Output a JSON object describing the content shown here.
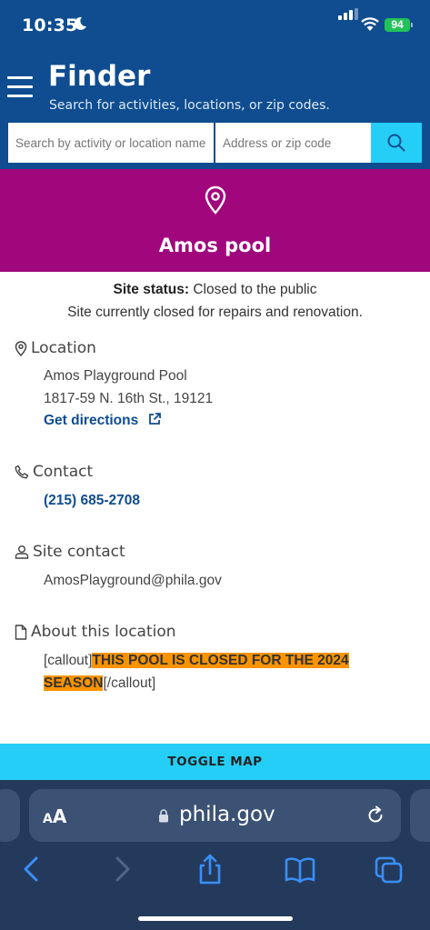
{
  "status_bar": {
    "time": "10:35",
    "battery": "94"
  },
  "header": {
    "title": "Finder",
    "subtitle": "Search for activities, locations, or zip codes.",
    "activity_placeholder": "Search by activity or location name",
    "address_placeholder": "Address or zip code"
  },
  "location": {
    "name": "Amos pool",
    "status_label": "Site status:",
    "status_value": "Closed to the public",
    "status_note": "Site currently closed for repairs and renovation."
  },
  "sections": {
    "location_heading": "Location",
    "location_name": "Amos Playground Pool",
    "address": "1817-59 N. 16th St., 19121",
    "directions_label": "Get directions",
    "contact_heading": "Contact",
    "phone": "(215) 685-2708",
    "site_contact_heading": "Site contact",
    "email": "AmosPlayground@phila.gov",
    "about_heading": "About this location",
    "about_open_tag": "[callout]",
    "about_highlight_1": "THIS POOL IS CLOSED FOR THE 2024",
    "about_highlight_2": "SEASON",
    "about_close_tag": "[/callout]"
  },
  "toggle_map_label": "TOGGLE MAP",
  "browser": {
    "text_size_label_big": "A",
    "text_size_label_small": "A",
    "domain": "phila.gov"
  },
  "colors": {
    "header_blue": "#0f4d90",
    "banner_magenta": "#a1077d",
    "accent_cyan": "#25cef7",
    "highlight_orange": "#f99300"
  }
}
